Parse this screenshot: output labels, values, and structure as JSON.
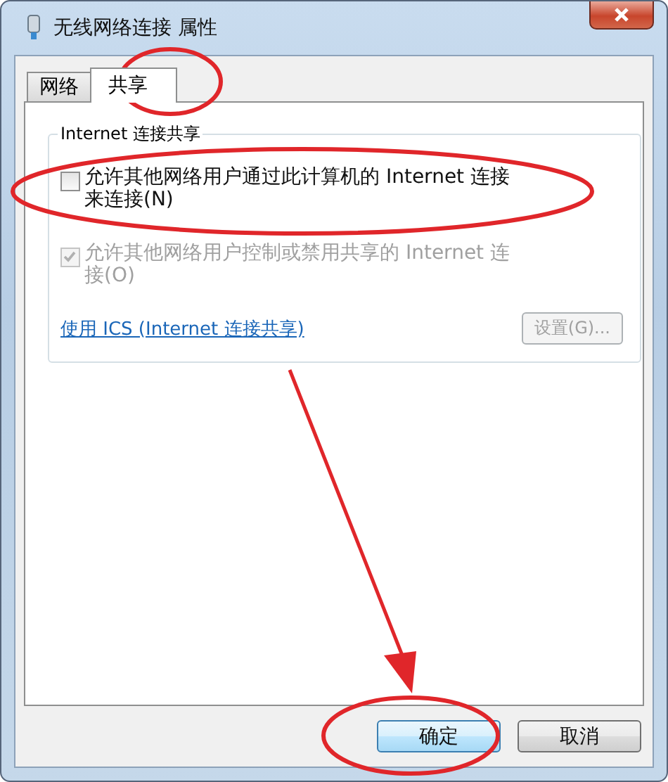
{
  "window": {
    "title": "无线网络连接 属性"
  },
  "tabs": [
    {
      "label": "网络",
      "selected": false
    },
    {
      "label": "共享",
      "selected": true
    }
  ],
  "group": {
    "title": "Internet 连接共享",
    "options": [
      {
        "label": "允许其他网络用户通过此计算机的 Internet 连接来连接(N)",
        "checked": false,
        "disabled": false
      },
      {
        "label": "允许其他网络用户控制或禁用共享的 Internet 连接(O)",
        "checked": true,
        "disabled": true
      }
    ],
    "link": "使用 ICS (Internet 连接共享)",
    "settings_button": {
      "label": "设置(G)...",
      "disabled": true
    }
  },
  "buttons": [
    {
      "label": "确定",
      "default": true
    },
    {
      "label": "取消",
      "default": false
    }
  ]
}
